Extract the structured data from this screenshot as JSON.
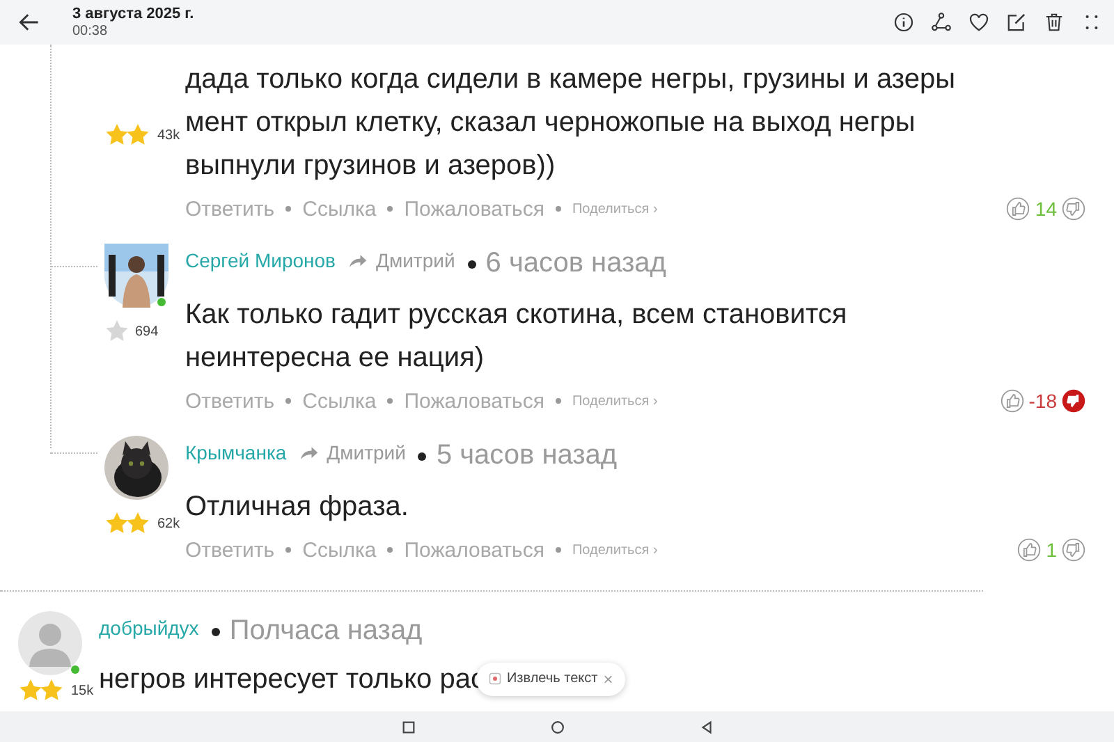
{
  "header": {
    "date": "3 августа 2025 г.",
    "time": "00:38"
  },
  "replies": [
    {
      "online": false,
      "badge": {
        "kind": "gold"
      },
      "score": "43k",
      "lines": [
        "дада только когда сидели в камере негры, грузины и азеры",
        "мент открыл клетку, сказал черножопые на выход негры",
        "выпнули грузинов и азеров))"
      ],
      "actions": [
        "Ответить",
        "Ссылка",
        "Пожаловаться"
      ],
      "share": "Поделиться ›",
      "rating": {
        "value": "14",
        "color": "#6cbf3a"
      },
      "disliked": false
    },
    {
      "author": "Сергей Миронов",
      "reply_to": "Дмитрий",
      "time_ago": "6 часов назад",
      "avatar": {
        "kind": "person"
      },
      "online": true,
      "badge": {
        "kind": "grey"
      },
      "score": "694",
      "lines": [
        "Как только гадит русская скотина, всем становится",
        "неинтересна ее нация)"
      ],
      "actions": [
        "Ответить",
        "Ссылка",
        "Пожаловаться"
      ],
      "share": "Поделиться ›",
      "rating": {
        "value": "-18",
        "color": "#c8393a"
      },
      "disliked": true
    },
    {
      "author": "Крымчанка",
      "reply_to": "Дмитрий",
      "time_ago": "5 часов назад",
      "avatar": {
        "kind": "picture"
      },
      "online": false,
      "badge": {
        "kind": "gold"
      },
      "score": "62k",
      "lines": [
        "Отличная фраза."
      ],
      "actions": [
        "Ответить",
        "Ссылка",
        "Пожаловаться"
      ],
      "share": "Поделиться ›",
      "rating": {
        "value": "1",
        "color": "#6cbf3a"
      },
      "disliked": false
    }
  ],
  "last_comment": {
    "author": "добрыйдух",
    "time_ago": "Полчаса назад",
    "avatar": {
      "kind": "default"
    },
    "online": true,
    "badge": {
      "kind": "gold"
    },
    "score": "15k",
    "lines": [
      "негров интересует только рас"
    ]
  },
  "chip": {
    "label": "Извлечь текст",
    "close": "×"
  }
}
